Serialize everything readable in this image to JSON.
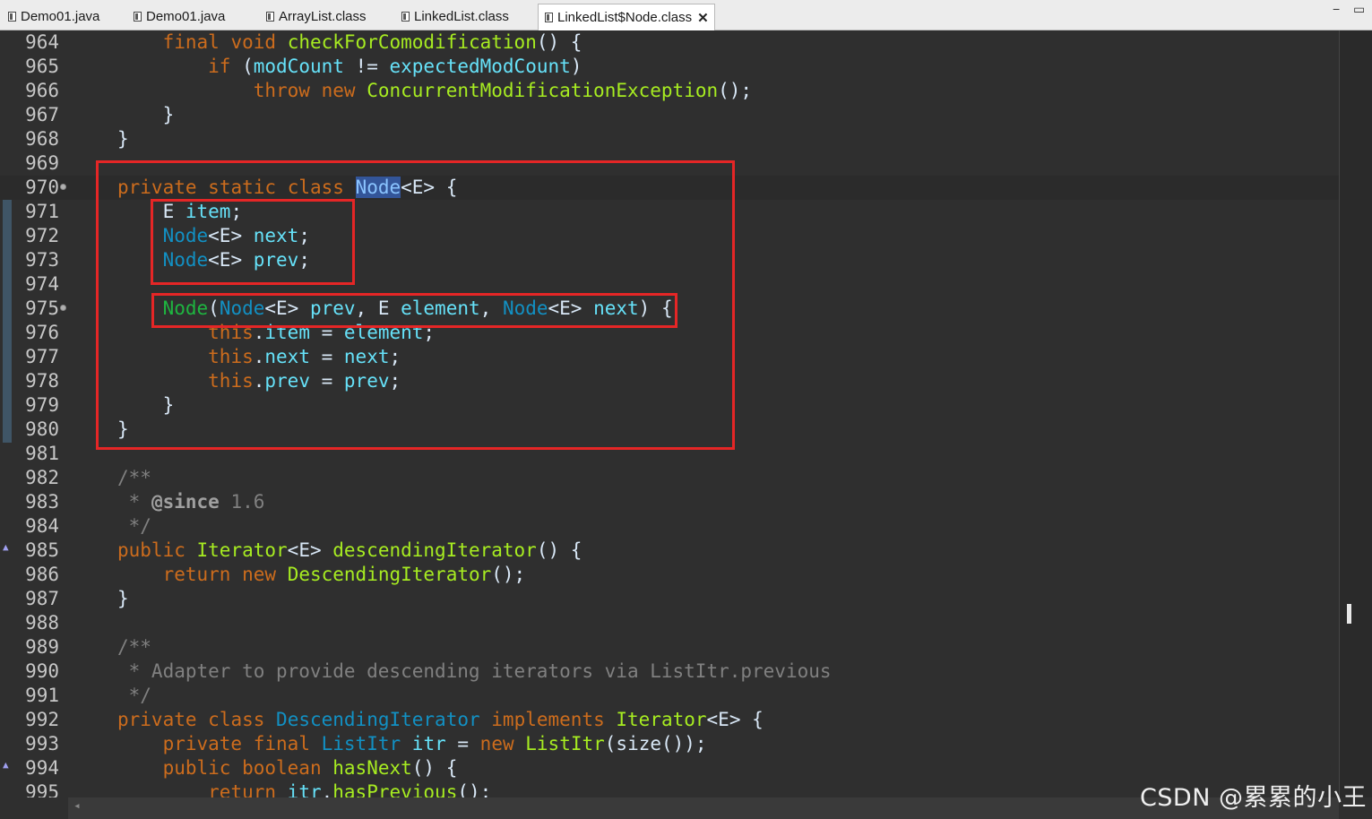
{
  "tabs": [
    {
      "label": "Demo01.java",
      "active": false
    },
    {
      "label": "Demo01.java",
      "active": false
    },
    {
      "label": "ArrayList.class",
      "active": false
    },
    {
      "label": "LinkedList.class",
      "active": false
    },
    {
      "label": "LinkedList$Node.class",
      "active": true
    }
  ],
  "window": {
    "minimize": "−",
    "maximize": "▭",
    "close_glyph": "✕"
  },
  "lines": [
    {
      "n": "964",
      "html": "    <span class='kw'>final</span> <span class='kw'>void</span> <span class='fn'>checkForComodification</span>() {"
    },
    {
      "n": "965",
      "html": "        <span class='kw'>if</span> (<span class='fld'>modCount</span> != <span class='fld'>expectedModCount</span>)"
    },
    {
      "n": "966",
      "html": "            <span class='kw'>throw</span> <span class='kw'>new</span> <span class='cls'>ConcurrentModificationException</span>();"
    },
    {
      "n": "967",
      "html": "    }"
    },
    {
      "n": "968",
      "html": "}"
    },
    {
      "n": "969",
      "html": ""
    },
    {
      "n": "970",
      "fold": true,
      "current": true,
      "html": "<span class='kw'>private</span> <span class='kw'>static</span> <span class='kw'>class</span> <span class='hl-sel'>Node</span>&lt;E&gt; {"
    },
    {
      "n": "971",
      "html": "    E <span class='fld'>item</span>;"
    },
    {
      "n": "972",
      "html": "    <span class='tp'>Node</span>&lt;E&gt; <span class='fld'>next</span>;"
    },
    {
      "n": "973",
      "html": "    <span class='tp'>Node</span>&lt;E&gt; <span class='fld'>prev</span>;"
    },
    {
      "n": "974",
      "html": ""
    },
    {
      "n": "975",
      "fold": true,
      "html": "    <span class='ctor'>Node</span>(<span class='tp'>Node</span>&lt;E&gt; <span class='fld'>prev</span>, E <span class='fld'>element</span>, <span class='tp'>Node</span>&lt;E&gt; <span class='fld'>next</span>) {"
    },
    {
      "n": "976",
      "html": "        <span class='kw'>this</span>.<span class='fld'>item</span> = <span class='fld'>element</span>;"
    },
    {
      "n": "977",
      "html": "        <span class='kw'>this</span>.<span class='fld'>next</span> = <span class='fld'>next</span>;"
    },
    {
      "n": "978",
      "html": "        <span class='kw'>this</span>.<span class='fld'>prev</span> = <span class='fld'>prev</span>;"
    },
    {
      "n": "979",
      "html": "    }"
    },
    {
      "n": "980",
      "html": "}"
    },
    {
      "n": "981",
      "html": ""
    },
    {
      "n": "982",
      "html": "<span class='cm'>/**</span>"
    },
    {
      "n": "983",
      "html": "<span class='cm'> * </span><span class='ann'>@since</span><span class='cm'> 1.6</span>"
    },
    {
      "n": "984",
      "html": "<span class='cm'> */</span>"
    },
    {
      "n": "985",
      "arrow": true,
      "html": "<span class='kw'>public</span> <span class='cls'>Iterator</span>&lt;E&gt; <span class='fn'>descendingIterator</span>() {"
    },
    {
      "n": "986",
      "html": "    <span class='kw'>return</span> <span class='kw'>new</span> <span class='cls'>DescendingIterator</span>();"
    },
    {
      "n": "987",
      "html": "}"
    },
    {
      "n": "988",
      "html": ""
    },
    {
      "n": "989",
      "html": "<span class='cm'>/**</span>"
    },
    {
      "n": "990",
      "html": "<span class='cm'> * Adapter to provide descending iterators via ListItr.previous</span>"
    },
    {
      "n": "991",
      "html": "<span class='cm'> */</span>"
    },
    {
      "n": "992",
      "html": "<span class='kw'>private</span> <span class='kw'>class</span> <span class='tp'>DescendingIterator</span> <span class='kw'>implements</span> <span class='cls'>Iterator</span>&lt;E&gt; {"
    },
    {
      "n": "993",
      "html": "    <span class='kw'>private</span> <span class='kw'>final</span> <span class='tp'>ListItr</span> <span class='fld'>itr</span> = <span class='kw'>new</span> <span class='cls'>ListItr</span>(size());"
    },
    {
      "n": "994",
      "arrow": true,
      "html": "    <span class='kw'>public</span> <span class='kw'>boolean</span> <span class='fn'>hasNext</span>() {"
    },
    {
      "n": "995",
      "html": "        <span class='kw'>return</span> <span class='fld'>itr</span>.<span class='fn'>hasPrevious</span>();"
    }
  ],
  "watermark": "CSDN @累累的小王"
}
